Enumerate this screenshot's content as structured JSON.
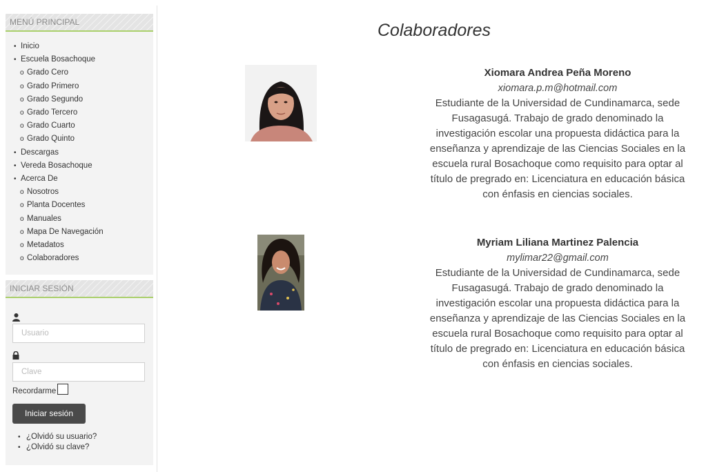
{
  "menu": {
    "title": "MENÚ PRINCIPAL",
    "items": [
      {
        "label": "Inicio",
        "level": 1
      },
      {
        "label": "Escuela Bosachoque",
        "level": 1
      },
      {
        "label": "Grado Cero",
        "level": 2
      },
      {
        "label": "Grado Primero",
        "level": 2
      },
      {
        "label": "Grado Segundo",
        "level": 2
      },
      {
        "label": "Grado Tercero",
        "level": 2
      },
      {
        "label": "Grado Cuarto",
        "level": 2
      },
      {
        "label": "Grado Quinto",
        "level": 2
      },
      {
        "label": "Descargas",
        "level": 1
      },
      {
        "label": "Vereda Bosachoque",
        "level": 1
      },
      {
        "label": "Acerca De",
        "level": 1
      },
      {
        "label": "Nosotros",
        "level": 2
      },
      {
        "label": "Planta Docentes",
        "level": 2
      },
      {
        "label": "Manuales",
        "level": 2
      },
      {
        "label": "Mapa De Navegación",
        "level": 2
      },
      {
        "label": "Metadatos",
        "level": 2
      },
      {
        "label": "Colaboradores",
        "level": 2
      }
    ]
  },
  "login": {
    "title": "INICIAR SESIÓN",
    "username_placeholder": "Usuario",
    "password_placeholder": "Clave",
    "remember_label": "Recordarme",
    "submit_label": "Iniciar sesión",
    "forgot_username": "¿Olvidó su usuario?",
    "forgot_password": "¿Olvidó su clave?"
  },
  "content": {
    "title": "Colaboradores",
    "collaborators": [
      {
        "name": "Xiomara Andrea Peña Moreno",
        "email": "xiomara.p.m@hotmail.com",
        "bio_lines": [
          "Estudiante de la Universidad de Cundinamarca, sede",
          "Fusagasugá. Trabajo de grado denominado la",
          "investigación escolar una propuesta didáctica para la",
          "enseñanza y aprendizaje de las Ciencias Sociales en la",
          "escuela rural Bosachoque como requisito para optar al",
          "título de pregrado en: Licenciatura en educación básica",
          "con énfasis en ciencias sociales."
        ]
      },
      {
        "name": "Myriam Liliana Martinez Palencia",
        "email": "mylimar22@gmail.com",
        "bio_lines": [
          "Estudiante de la Universidad de Cundinamarca, sede",
          "Fusagasugá. Trabajo de grado denominado la",
          "investigación escolar una propuesta didáctica para la",
          "enseñanza y aprendizaje de las Ciencias Sociales en la",
          "escuela rural Bosachoque como requisito para optar al",
          "título de pregrado en: Licenciatura en educación básica",
          "con énfasis en ciencias sociales."
        ]
      }
    ]
  }
}
